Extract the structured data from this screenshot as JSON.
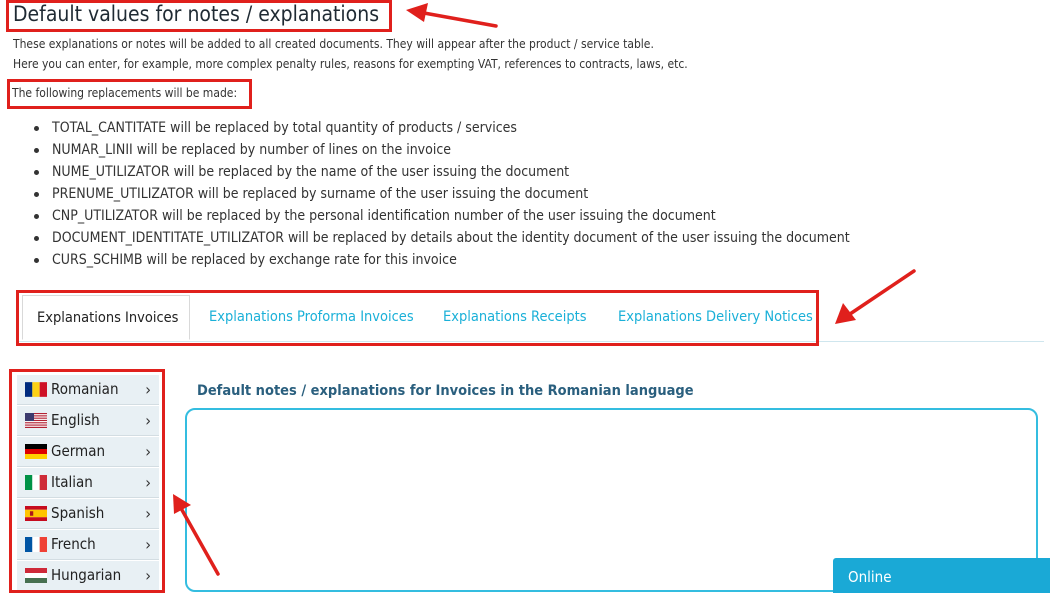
{
  "page": {
    "title": "Default values for notes / explanations",
    "description_line1": "These explanations or notes will be added to all created documents. They will appear after the product / service table.",
    "description_line2": "Here you can enter, for example, more complex penalty rules, reasons for exempting VAT, references to contracts, laws, etc.",
    "replacements_heading": "The following replacements will be made:"
  },
  "replacements": [
    "TOTAL_CANTITATE will be replaced by total quantity of products / services",
    "NUMAR_LINII will be replaced by number of lines on the invoice",
    "NUME_UTILIZATOR will be replaced by the name of the user issuing the document",
    "PRENUME_UTILIZATOR will be replaced by surname of the user issuing the document",
    "CNP_UTILIZATOR will be replaced by the personal identification number of the user issuing the document",
    "DOCUMENT_IDENTITATE_UTILIZATOR will be replaced by details about the identity document of the user issuing the document",
    "CURS_SCHIMB will be replaced by exchange rate for this invoice"
  ],
  "tabs": [
    {
      "label": "Explanations Invoices",
      "active": true
    },
    {
      "label": "Explanations Proforma Invoices",
      "active": false
    },
    {
      "label": "Explanations Receipts",
      "active": false
    },
    {
      "label": "Explanations Delivery Notices",
      "active": false
    }
  ],
  "languages": [
    {
      "label": "Romanian",
      "flag": "romania-flag-icon"
    },
    {
      "label": "English",
      "flag": "usa-flag-icon"
    },
    {
      "label": "German",
      "flag": "germany-flag-icon"
    },
    {
      "label": "Italian",
      "flag": "italy-flag-icon"
    },
    {
      "label": "Spanish",
      "flag": "spain-flag-icon"
    },
    {
      "label": "French",
      "flag": "france-flag-icon"
    },
    {
      "label": "Hungarian",
      "flag": "hungary-flag-icon"
    }
  ],
  "chevron": "›",
  "editor": {
    "label": "Default notes / explanations for Invoices in the Romanian language",
    "value": ""
  },
  "chat": {
    "status_label": "Online"
  },
  "colors": {
    "accent": "#1ab0d8",
    "highlight_red": "#e0201c",
    "editor_border": "#34bde0",
    "chat_bg": "#1aa9d6"
  }
}
